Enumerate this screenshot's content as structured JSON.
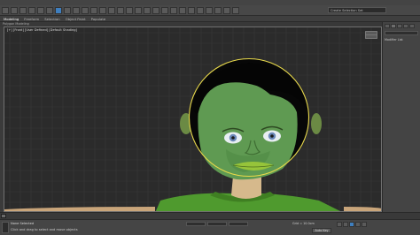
{
  "toolbar": {
    "search_value": "Create Selection Set",
    "accent_color": "#3f7fbf"
  },
  "ribbon": {
    "tabs": [
      "Modeling",
      "Freeform",
      "Selection",
      "Object Paint",
      "Populate"
    ]
  },
  "subribbon": {
    "label": "Polygon Modeling"
  },
  "viewport": {
    "label": "[+] [Front] [User Defined] [Default Shading]",
    "background": "#2b2b2b",
    "selection_color": "#e8d94a"
  },
  "command_panel": {
    "label": "Modifier List"
  },
  "status": {
    "selected": "None Selected",
    "prompt": "Click and drag to select and move objects",
    "grid": "Grid = 10.0cm",
    "autokey": "Auto Key"
  },
  "icons": {
    "viewcube": "viewcube-icon",
    "maxscript": "maxscript-listener-icon"
  }
}
